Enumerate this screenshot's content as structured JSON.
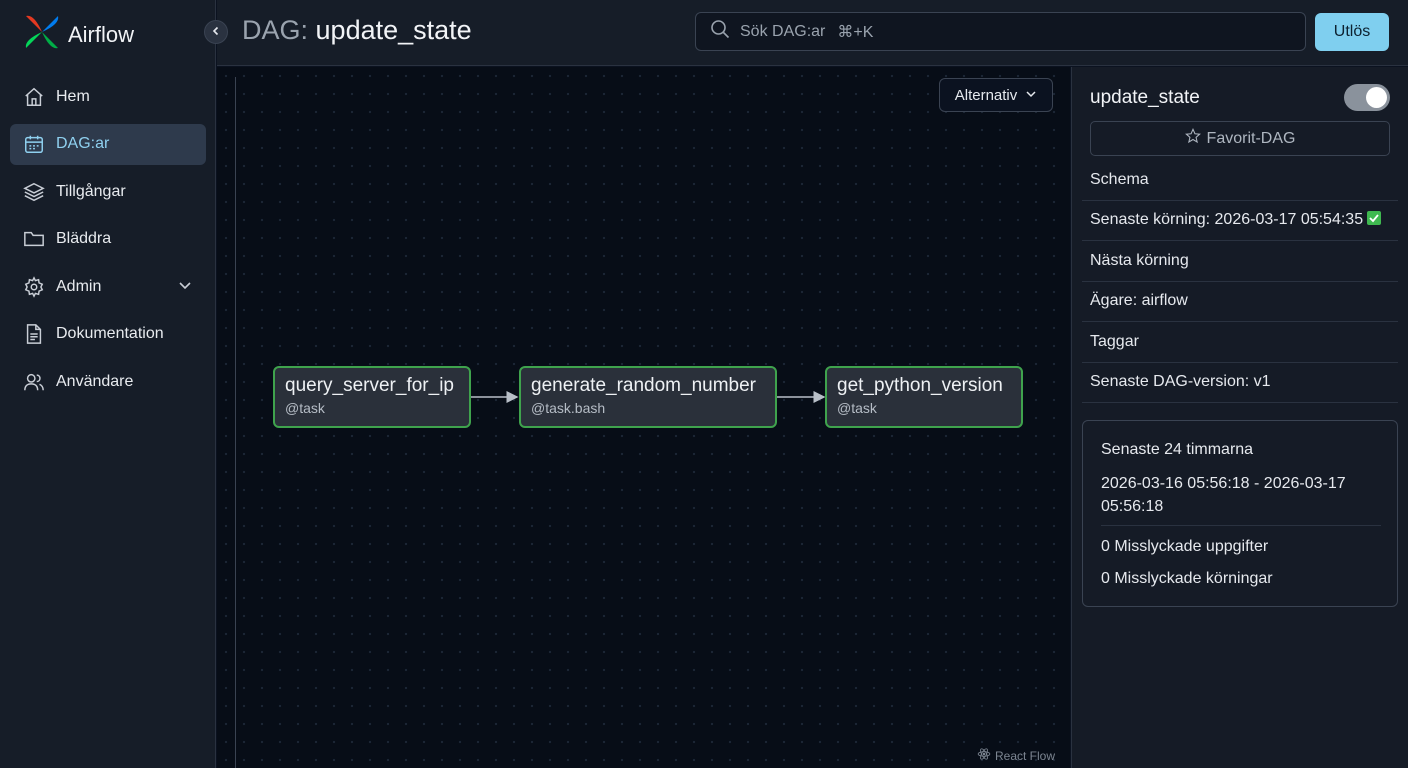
{
  "app": {
    "name": "Airflow"
  },
  "sidebar": {
    "items": [
      {
        "label": "Hem",
        "icon": "home-icon",
        "active": false
      },
      {
        "label": "DAG:ar",
        "icon": "calendar-icon",
        "active": true
      },
      {
        "label": "Tillgångar",
        "icon": "layers-icon",
        "active": false
      },
      {
        "label": "Bläddra",
        "icon": "folder-icon",
        "active": false
      },
      {
        "label": "Admin",
        "icon": "gear-icon",
        "active": false,
        "expandable": true
      },
      {
        "label": "Dokumentation",
        "icon": "document-icon",
        "active": false
      },
      {
        "label": "Användare",
        "icon": "users-icon",
        "active": false
      }
    ]
  },
  "header": {
    "title_prefix": "DAG:",
    "title_name": "update_state",
    "search_placeholder": "Sök DAG:ar",
    "search_shortcut": "⌘+K",
    "logout_label": "Utlös"
  },
  "graph": {
    "options_label": "Alternativ",
    "nodes": [
      {
        "title": "query_server_for_ip",
        "subtitle": "@task"
      },
      {
        "title": "generate_random_number",
        "subtitle": "@task.bash"
      },
      {
        "title": "get_python_version",
        "subtitle": "@task"
      }
    ],
    "attribution": "React Flow"
  },
  "details": {
    "dag_name": "update_state",
    "favorite_label": "Favorit-DAG",
    "rows": [
      "Schema",
      "Senaste körning: 2026-03-17 05:54:35",
      "Nästa körning",
      "Ägare: airflow",
      "Taggar",
      "Senaste DAG-version: v1"
    ],
    "stats": {
      "title": "Senaste 24 timmarna",
      "range": "2026-03-16 05:56:18 - 2026-03-17 05:56:18",
      "failed_tasks": "0 Misslyckade uppgifter",
      "failed_runs": "0 Misslyckade körningar"
    }
  },
  "colors": {
    "accent": "#7fcfef",
    "success": "#3fa34d",
    "background": "#0b1220"
  }
}
